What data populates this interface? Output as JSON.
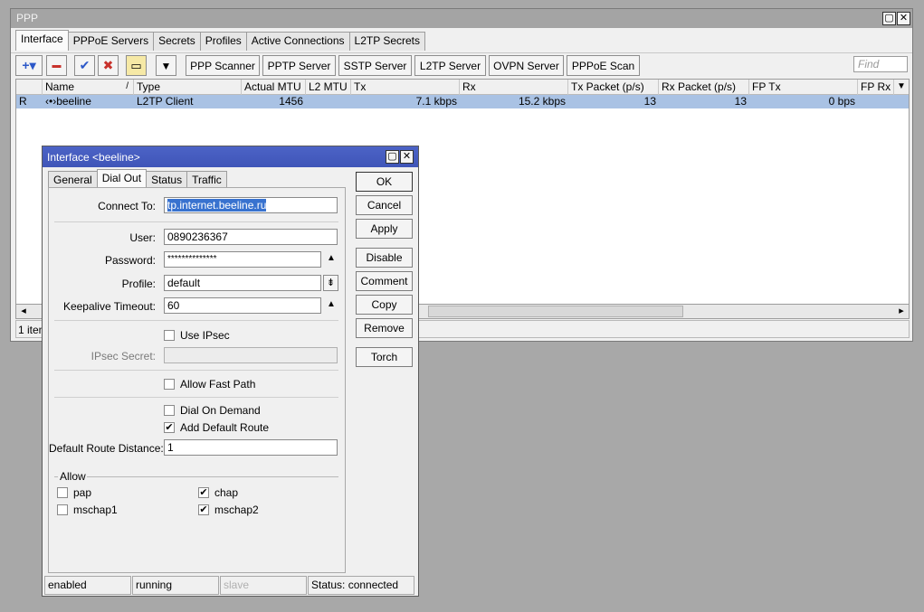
{
  "ppp_window": {
    "title": "PPP",
    "restore_glyph": "▢",
    "close_glyph": "✕",
    "tabs": [
      {
        "label": "Interface",
        "active": true
      },
      {
        "label": "PPPoE Servers"
      },
      {
        "label": "Secrets"
      },
      {
        "label": "Profiles"
      },
      {
        "label": "Active Connections"
      },
      {
        "label": "L2TP Secrets"
      }
    ],
    "toolbar": {
      "add_glyph": "+▾",
      "remove_glyph": "▬",
      "enable_glyph": "✔",
      "disable_glyph": "✖",
      "comment_glyph": "▭",
      "filter_glyph": "▼",
      "ppp_scanner": "PPP Scanner",
      "pptp_server": "PPTP Server",
      "sstp_server": "SSTP Server",
      "l2tp_server": "L2TP Server",
      "ovpn_server": "OVPN Server",
      "pppoe_scan": "PPPoE Scan",
      "find_placeholder": "Find"
    },
    "table": {
      "columns": [
        "",
        "Name",
        "Type",
        "Actual MTU",
        "L2 MTU",
        "Tx",
        "Rx",
        "Tx Packet (p/s)",
        "Rx Packet (p/s)",
        "FP Tx",
        "FP Rx"
      ],
      "sort_glyph": "/",
      "menu_glyph": "▼",
      "rows": [
        {
          "flag": "R",
          "name": "‹•›beeline",
          "type": "L2TP Client",
          "actual_mtu": "1456",
          "l2_mtu": "",
          "tx": "7.1 kbps",
          "rx": "15.2 kbps",
          "tx_packet": "13",
          "rx_packet": "13",
          "fp_tx": "0 bps",
          "fp_rx": ""
        }
      ]
    },
    "scroll_left_glyph": "◂",
    "scroll_right_glyph": "▸",
    "status_text": "1 item"
  },
  "dialog": {
    "title": "Interface <beeline>",
    "restore_glyph": "▢",
    "close_glyph": "✕",
    "tabs": [
      {
        "label": "General"
      },
      {
        "label": "Dial Out",
        "active": true
      },
      {
        "label": "Status"
      },
      {
        "label": "Traffic"
      }
    ],
    "fields": {
      "connect_to_label": "Connect To:",
      "connect_to_value": "tp.internet.beeline.ru",
      "user_label": "User:",
      "user_value": "0890236367",
      "password_label": "Password:",
      "password_value": "**************",
      "profile_label": "Profile:",
      "profile_value": "default",
      "keepalive_label": "Keepalive Timeout:",
      "keepalive_value": "60",
      "use_ipsec_label": "Use IPsec",
      "use_ipsec_checked": false,
      "ipsec_secret_label": "IPsec Secret:",
      "ipsec_secret_value": "",
      "allow_fast_path_label": "Allow Fast Path",
      "allow_fast_path_checked": false,
      "dial_on_demand_label": "Dial On Demand",
      "dial_on_demand_checked": false,
      "add_default_route_label": "Add Default Route",
      "add_default_route_checked": true,
      "default_route_distance_label": "Default Route Distance:",
      "default_route_distance_value": "1"
    },
    "up_glyph": "▲",
    "dropdown_glyph": "⇟",
    "allow": {
      "legend": "Allow",
      "items": [
        {
          "label": "pap",
          "checked": false
        },
        {
          "label": "chap",
          "checked": true
        },
        {
          "label": "mschap1",
          "checked": false
        },
        {
          "label": "mschap2",
          "checked": true
        }
      ]
    },
    "check_glyph": "✔",
    "buttons": {
      "ok": "OK",
      "cancel": "Cancel",
      "apply": "Apply",
      "disable": "Disable",
      "comment": "Comment",
      "copy": "Copy",
      "remove": "Remove",
      "torch": "Torch"
    },
    "status": {
      "enabled": "enabled",
      "running": "running",
      "slave": "slave",
      "connection": "Status: connected"
    }
  },
  "colors": {
    "selected_row": "#a9c2e4",
    "dialog_title": "#4c63c6",
    "add_icon": "#2c58c8",
    "remove_icon": "#c8322c"
  }
}
